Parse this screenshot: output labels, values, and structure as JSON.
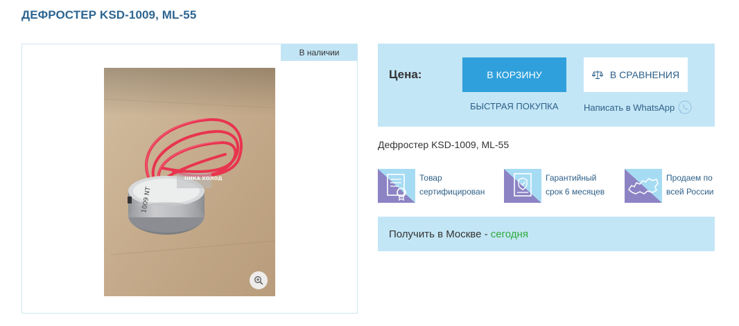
{
  "product": {
    "title": "ДЕФРОСТЕР KSD-1009, ML-55",
    "description": "Дефростер KSD-1009, ML-55"
  },
  "gallery": {
    "stock_badge": "В наличии",
    "photo_watermark": "НИКА ХОЛОД",
    "zoom_icon": "zoom-in-icon"
  },
  "purchase": {
    "price_label": "Цена:",
    "cart_button": "В КОРЗИНУ",
    "compare_button": "В СРАВНЕНИЯ",
    "compare_icon": "scales-icon",
    "quick_buy": "БЫСТРАЯ ПОКУПКА",
    "whatsapp": "Написать в WhatsApp",
    "whatsapp_icon": "whatsapp-icon"
  },
  "features": [
    {
      "line1": "Товар",
      "line2": "сертифицирован",
      "icon": "certificate-icon"
    },
    {
      "line1": "Гарантийный",
      "line2": "срок 6 месяцев",
      "icon": "warranty-icon"
    },
    {
      "line1": "Продаем по",
      "line2": "всей России",
      "icon": "russia-map-icon"
    }
  ],
  "delivery": {
    "prefix": "Получить в Москве - ",
    "when": "сегодня"
  },
  "colors": {
    "title": "#2d6591",
    "accent_blue": "#2fa0db",
    "panel_bg": "#c3e6f6",
    "link": "#2d5f88",
    "today_green": "#2faa3b"
  }
}
